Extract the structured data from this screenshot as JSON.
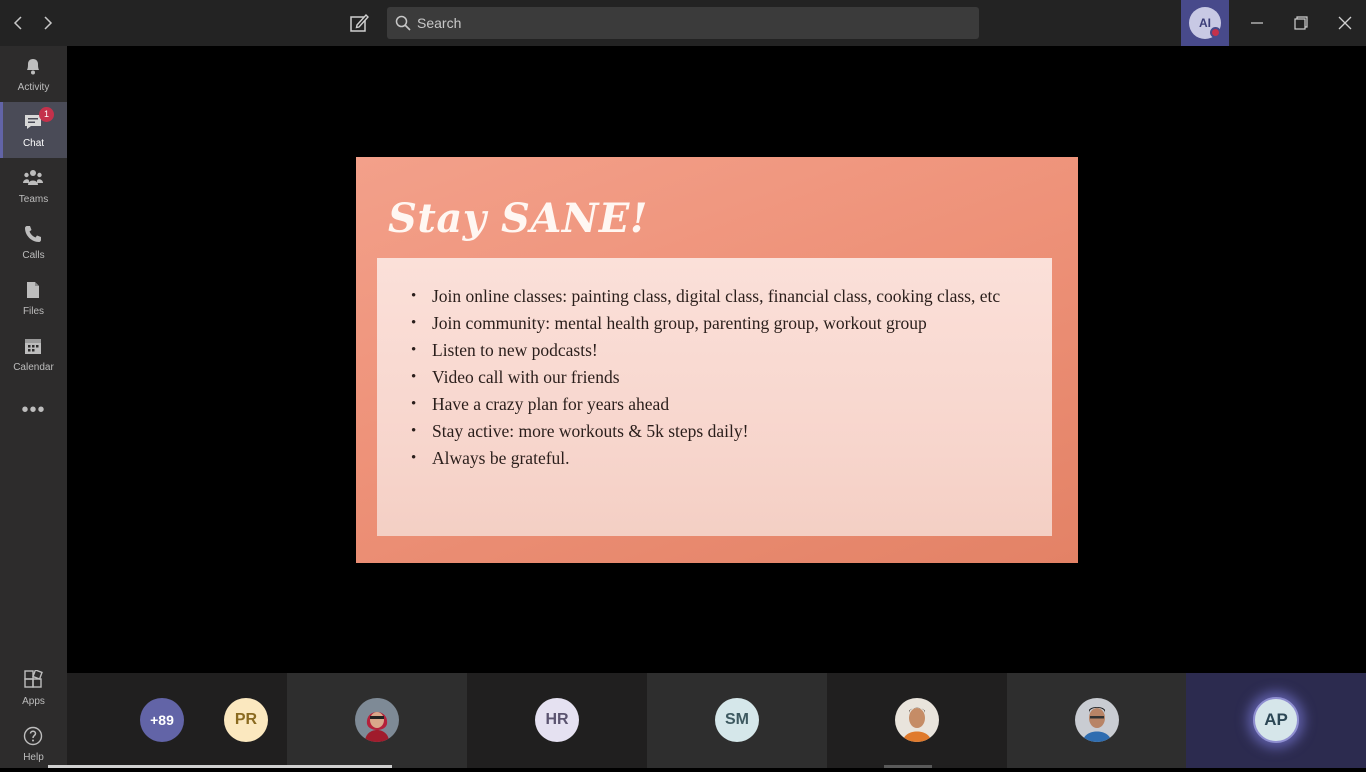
{
  "titlebar": {
    "search_placeholder": "Search",
    "profile_initials": "AI",
    "nav_back_icon": "chevron-left-icon",
    "nav_forward_icon": "chevron-right-icon",
    "compose_icon": "compose-icon",
    "search_icon": "search-icon",
    "window_buttons": [
      "minimize-icon",
      "restore-icon",
      "close-icon"
    ]
  },
  "rail": {
    "items": [
      {
        "label": "Activity",
        "icon": "bell-icon"
      },
      {
        "label": "Chat",
        "icon": "chat-icon",
        "badge": "1"
      },
      {
        "label": "Teams",
        "icon": "teams-icon"
      },
      {
        "label": "Calls",
        "icon": "phone-icon"
      },
      {
        "label": "Files",
        "icon": "file-icon"
      },
      {
        "label": "Calendar",
        "icon": "calendar-icon"
      }
    ],
    "more": "•••",
    "bottom": [
      {
        "label": "Apps",
        "icon": "apps-icon"
      },
      {
        "label": "Help",
        "icon": "help-icon"
      }
    ]
  },
  "slide": {
    "title": "Stay SANE!",
    "bullets": [
      "Join online classes: painting class, digital class, financial class, cooking class, etc",
      "Join community: mental health group, parenting group, workout group",
      "Listen to new podcasts!",
      "Video call with our friends",
      "Have a  crazy plan for years ahead",
      "Stay active: more workouts & 5k steps daily!",
      "Always be grateful."
    ]
  },
  "participants": {
    "overflow_count": "+89",
    "pr": "PR",
    "hr": "HR",
    "sm": "SM",
    "self": "AP"
  },
  "colors": {
    "accent": "#6264a7",
    "badge": "#c4314b",
    "slide_bg": "#ee9279"
  }
}
